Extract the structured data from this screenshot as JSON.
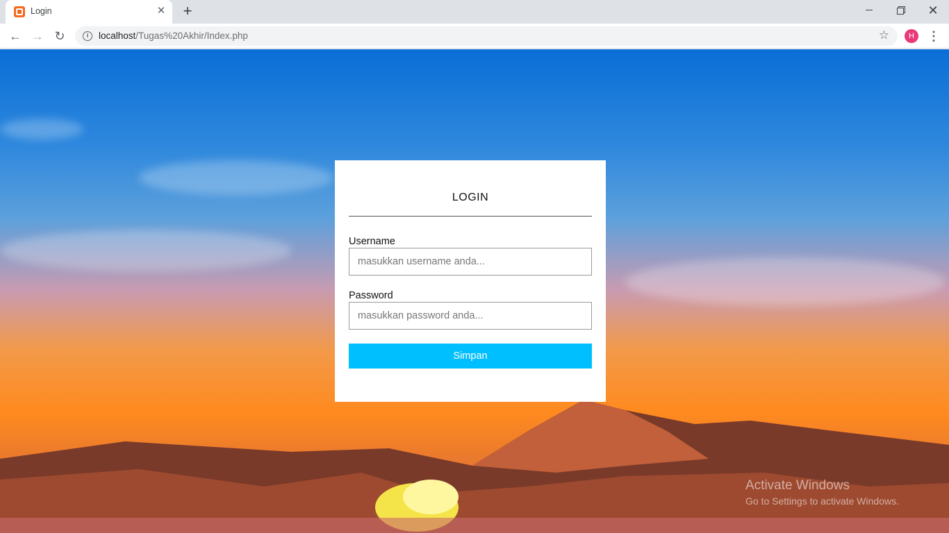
{
  "browser": {
    "tab_title": "Login",
    "tab_close": "✕",
    "new_tab": "+",
    "url_host": "localhost",
    "url_path": "/Tugas%20Akhir/Index.php",
    "avatar_letter": "H",
    "window_close": "✕"
  },
  "login": {
    "title": "LOGIN",
    "username_label": "Username",
    "username_placeholder": "masukkan username anda...",
    "password_label": "Password",
    "password_placeholder": "masukkan password anda...",
    "submit_label": "Simpan",
    "accent_color": "#00bfff"
  },
  "watermark": {
    "title": "Activate Windows",
    "subtitle": "Go to Settings to activate Windows."
  }
}
